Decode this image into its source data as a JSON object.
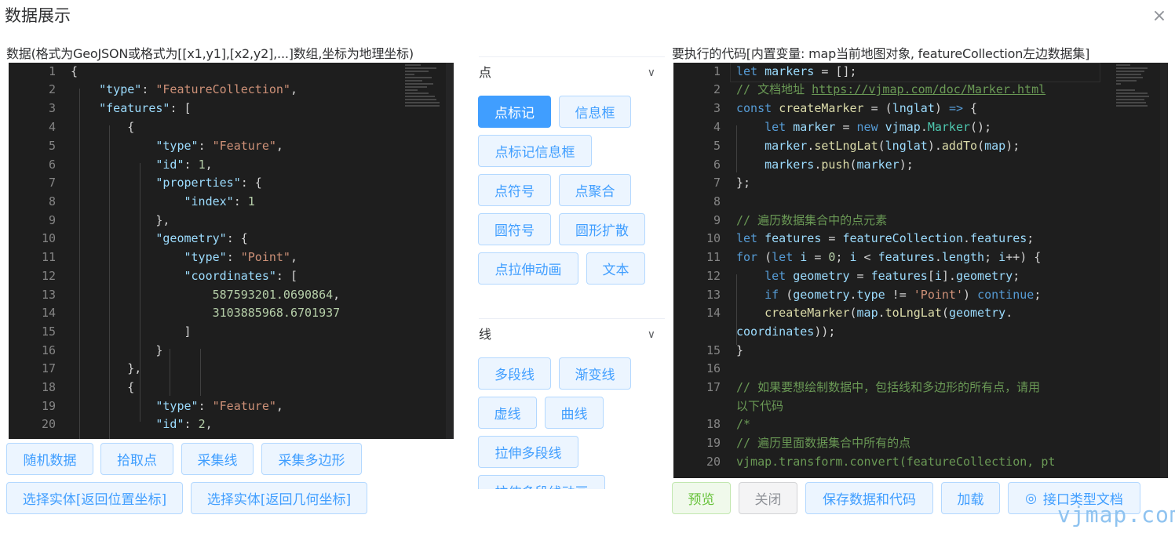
{
  "dialog": {
    "title": "数据展示",
    "close_icon": "×"
  },
  "left_panel": {
    "label": "数据(格式为GeoJSON或格式为[[x1,y1],[x2,y2],...]数组,坐标为地理坐标)",
    "buttons": [
      "随机数据",
      "拾取点",
      "采集线",
      "采集多边形",
      "选择实体[返回位置坐标]",
      "选择实体[返回几何坐标]"
    ]
  },
  "middle_panel": {
    "sections": [
      {
        "title": "点",
        "items": [
          "点标记",
          "信息框",
          "点标记信息框",
          "点符号",
          "点聚合",
          "圆符号",
          "圆形扩散",
          "点拉伸动画",
          "文本"
        ],
        "active": "点标记"
      },
      {
        "title": "线",
        "items": [
          "多段线",
          "渐变线",
          "虚线",
          "曲线",
          "拉伸多段线",
          "拉伸多段线动画"
        ]
      }
    ]
  },
  "right_panel": {
    "label": "要执行的代码[内置变量: map当前地图对象, featureCollection左边数据集]",
    "buttons": [
      "预览",
      "关闭",
      "保存数据和代码",
      "加载",
      "接口类型文档"
    ],
    "doc_icon": "◎"
  },
  "watermark": "vjmap.com"
}
